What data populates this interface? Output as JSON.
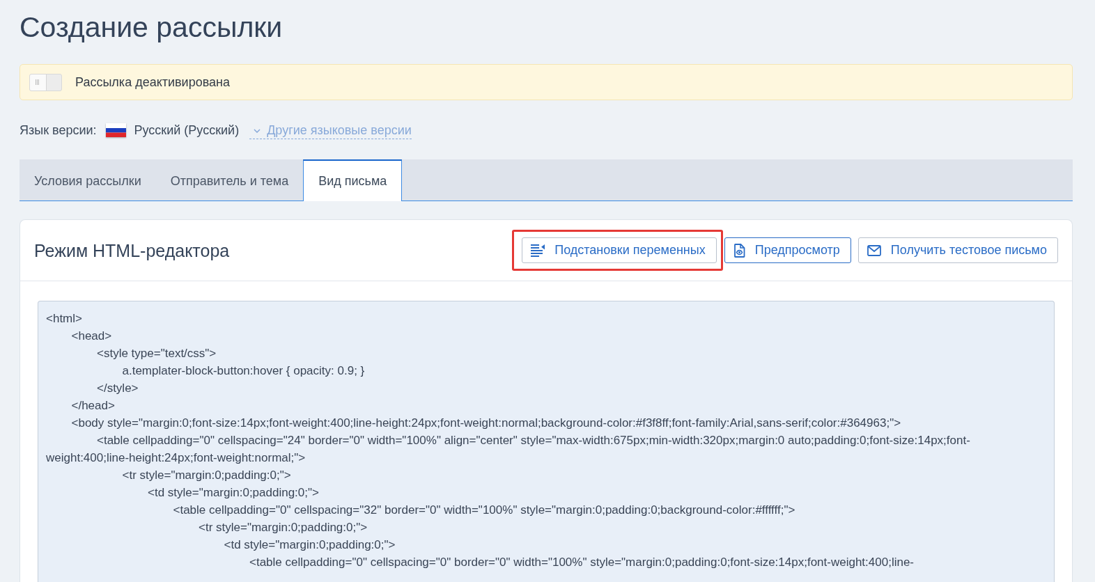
{
  "page_title": "Создание рассылки",
  "activation": {
    "on": false,
    "label": "Рассылка деактивирована"
  },
  "language": {
    "label": "Язык версии:",
    "current": "Русский (Русский)",
    "other_link": "Другие языковые версии"
  },
  "tabs": [
    {
      "label": "Условия рассылки",
      "selected": false
    },
    {
      "label": "Отправитель и тема",
      "selected": false
    },
    {
      "label": "Вид письма",
      "selected": true
    }
  ],
  "editor": {
    "title": "Режим HTML-редактора",
    "buttons": [
      {
        "label": "Подстановки переменных",
        "focused": false,
        "highlighted": true
      },
      {
        "label": "Предпросмотр",
        "focused": true,
        "highlighted": false
      },
      {
        "label": "Получить тестовое письмо",
        "focused": false,
        "highlighted": false
      }
    ],
    "code": [
      {
        "text": "<html>",
        "children": [
          {
            "text": "<head>",
            "children": [
              {
                "text": "<style type=\"text/css\">",
                "children": [
                  {
                    "text": "a.templater-block-button:hover { opacity: 0.9; }"
                  }
                ]
              },
              {
                "text": "</style>"
              }
            ]
          },
          {
            "text": "</head>"
          },
          {
            "text": "<body style=\"margin:0;font-size:14px;font-weight:400;line-height:24px;font-weight:normal;background-color:#f3f8ff;font-family:Arial,sans-serif;color:#364963;\">",
            "children": [
              {
                "text": "<table cellpadding=\"0\" cellspacing=\"24\" border=\"0\" width=\"100%\" align=\"center\" style=\"max-width:675px;min-width:320px;margin:0 auto;padding:0;font-size:14px;font-weight:400;line-height:24px;font-weight:normal;\">",
                "children": [
                  {
                    "text": "<tr style=\"margin:0;padding:0;\">",
                    "children": [
                      {
                        "text": "<td style=\"margin:0;padding:0;\">",
                        "children": [
                          {
                            "text": "<table cellpadding=\"0\" cellspacing=\"32\" border=\"0\" width=\"100%\" style=\"margin:0;padding:0;background-color:#ffffff;\">",
                            "children": [
                              {
                                "text": "<tr style=\"margin:0;padding:0;\">",
                                "children": [
                                  {
                                    "text": "<td style=\"margin:0;padding:0;\">",
                                    "children": [
                                      {
                                        "text": "<table cellpadding=\"0\" cellspacing=\"0\" border=\"0\" width=\"100%\" style=\"margin:0;padding:0;font-size:14px;font-weight:400;line-"
                                      }
                                    ]
                                  }
                                ]
                              }
                            ]
                          }
                        ]
                      }
                    ]
                  }
                ]
              }
            ]
          }
        ]
      }
    ]
  }
}
